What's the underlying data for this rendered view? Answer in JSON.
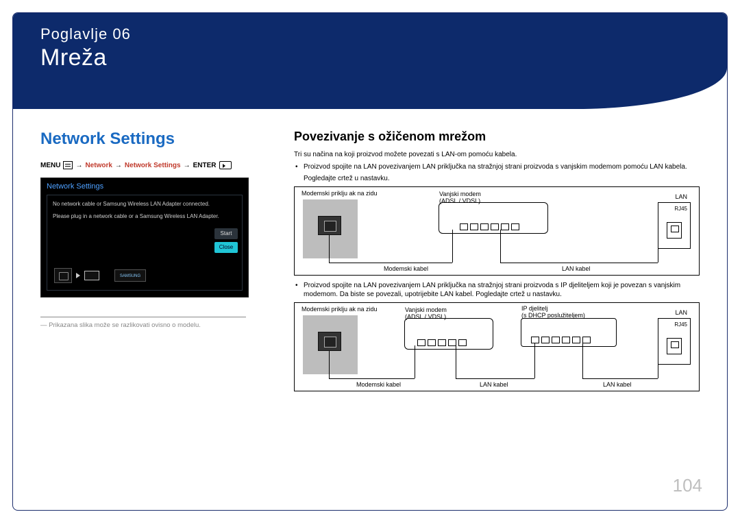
{
  "chapter": {
    "label": "Poglavlje  06",
    "title": "Mreža"
  },
  "left": {
    "heading": "Network Settings",
    "menu_path": {
      "menu": "MENU",
      "arrow": "→",
      "network": "Network",
      "network_settings": "Network Settings",
      "enter": "ENTER"
    },
    "tv": {
      "title": "Network Settings",
      "line1": "No network cable or Samsung Wireless LAN Adapter connected.",
      "line2": "Please plug in a network cable or a Samsung Wireless LAN Adapter.",
      "start": "Start",
      "close": "Close",
      "usb": "SAMSUNG"
    },
    "note": "Prikazana slika može se razlikovati ovisno o modelu."
  },
  "right": {
    "subheading": "Povezivanje s ožičenom mrežom",
    "intro": "Tri su načina na koji proizvod možete povezati s LAN-om pomoću kabela.",
    "bullet1": "Proizvod spojite na LAN povezivanjem LAN priključka na stražnjoj strani proizvoda s vanjskim modemom pomoću LAN kabela.",
    "see_below": "Pogledajte crtež u nastavku.",
    "bullet2": "Proizvod spojite na LAN povezivanjem LAN priključka na stražnjoj strani proizvoda s IP djeliteljem koji je povezan s vanjskim modemom. Da biste se povezali, upotrijebite LAN kabel. Pogledajte crtež u nastavku.",
    "diagram_common": {
      "wall": "Modemski priklju  ak na zidu",
      "modem": "Vanjski modem",
      "modem_sub": "(ADSL / VDSL)",
      "lan": "LAN",
      "rj45": "RJ45",
      "modem_cable": "Modemski kabel",
      "lan_cable": "LAN kabel",
      "ip_sharer": "IP djelitelj",
      "ip_sharer_sub": "(s DHCP poslužiteljem)"
    }
  },
  "page_number": "104"
}
